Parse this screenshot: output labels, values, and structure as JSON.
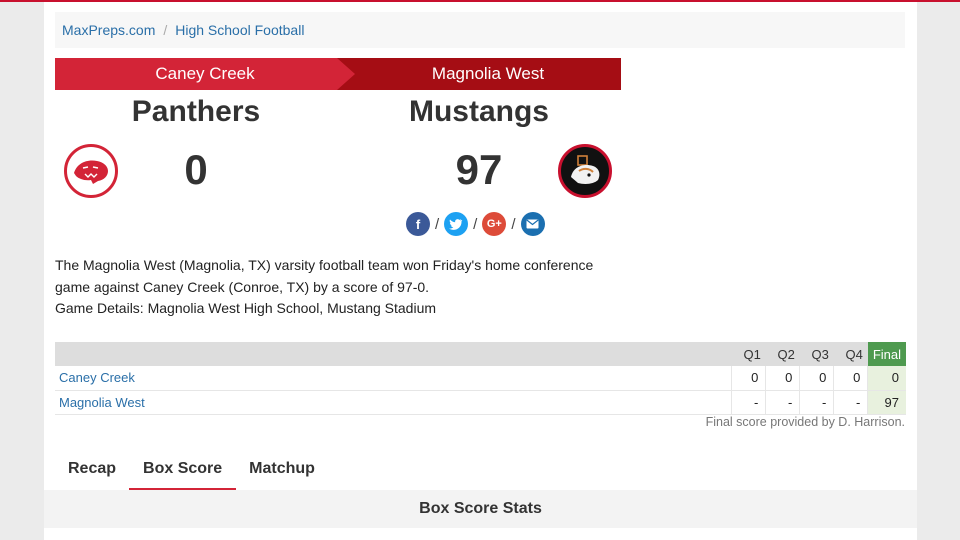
{
  "breadcrumb": {
    "items": [
      "MaxPreps.com",
      "High School Football"
    ]
  },
  "away": {
    "school": "Caney Creek",
    "mascot": "Panthers",
    "score": "0",
    "logo_icon": "panther-logo-icon",
    "color": "#d32437"
  },
  "home": {
    "school": "Magnolia West",
    "mascot": "Mustangs",
    "score": "97",
    "logo_icon": "mustang-logo-icon",
    "color": "#a50d14"
  },
  "social": {
    "facebook": {
      "glyph": "f",
      "color": "#3b5998"
    },
    "twitter": {
      "glyph": "t",
      "color": "#1da1f2"
    },
    "googleplus": {
      "glyph": "G+",
      "color": "#dd4b39"
    },
    "email": {
      "glyph": "✉",
      "color": "#1b6fb0"
    },
    "separator": "/"
  },
  "description": {
    "line1": "The Magnolia West (Magnolia, TX) varsity football team won Friday's home conference",
    "line2": "game against Caney Creek (Conroe, TX) by a score of 97-0.",
    "line3": "Game Details: Magnolia West High School, Mustang Stadium"
  },
  "linescore": {
    "headers": [
      "Q1",
      "Q2",
      "Q3",
      "Q4",
      "Final"
    ],
    "rows": [
      {
        "team": "Caney Creek",
        "q": [
          "0",
          "0",
          "0",
          "0"
        ],
        "final": "0"
      },
      {
        "team": "Magnolia West",
        "q": [
          "-",
          "-",
          "-",
          "-"
        ],
        "final": "97"
      }
    ],
    "final_color": "#4e9a4f"
  },
  "credit": "Final score provided by D. Harrison.",
  "tabs": [
    "Recap",
    "Box Score",
    "Matchup"
  ],
  "active_tab": "Box Score",
  "stats_title": "Box Score Stats"
}
